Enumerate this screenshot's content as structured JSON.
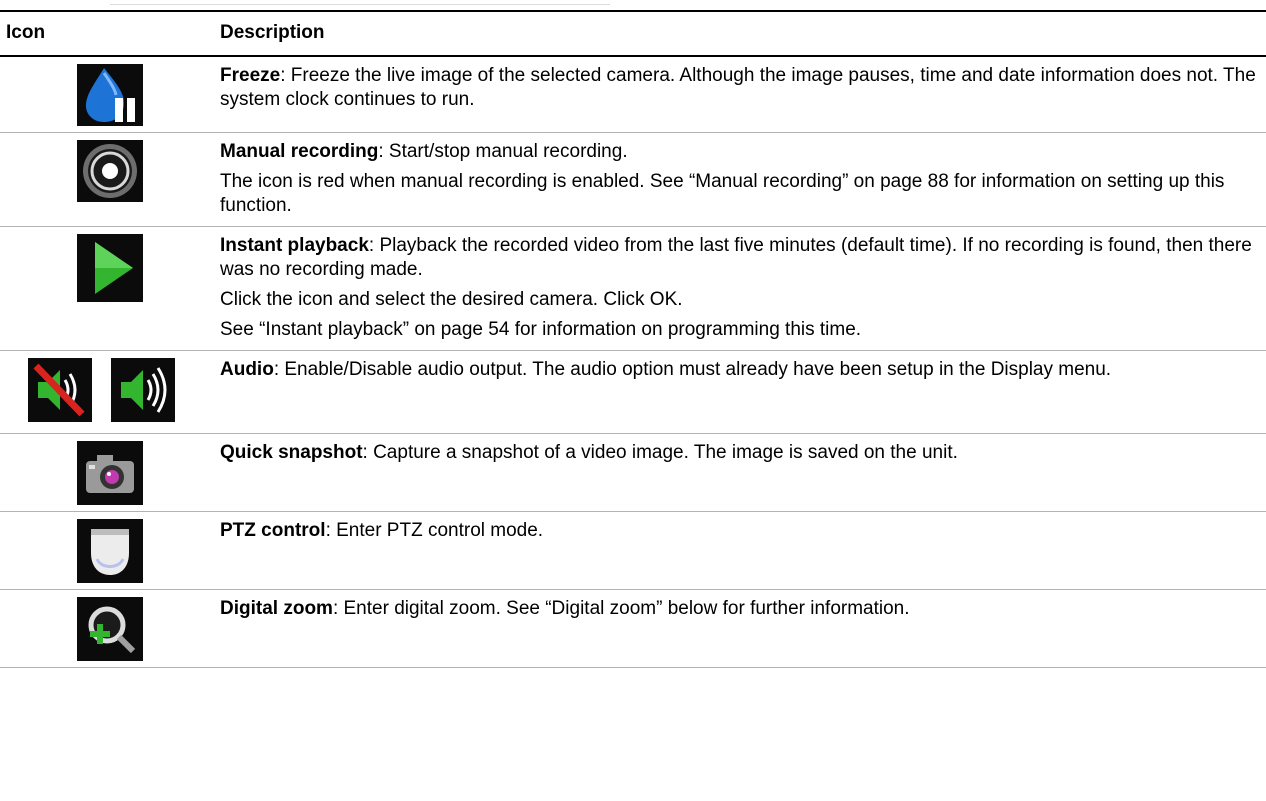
{
  "table": {
    "header": {
      "icon": "Icon",
      "description": "Description"
    },
    "rows": [
      {
        "icon": "freeze-icon",
        "term": "Freeze",
        "paragraphs": [
          ": Freeze the live image of the selected camera. Although the image pauses, time and date information does not. The system clock continues to run."
        ]
      },
      {
        "icon": "manual-recording-icon",
        "term": "Manual recording",
        "paragraphs": [
          ": Start/stop manual recording.",
          "The icon is red when manual recording is enabled. See “Manual recording” on page 88 for information on setting up this function."
        ]
      },
      {
        "icon": "instant-playback-icon",
        "term": "Instant playback",
        "paragraphs": [
          ": Playback the recorded video from the last five minutes (default time). If no recording is found, then there was no recording made.",
          "Click the icon and select the desired camera. Click OK.",
          "See “Instant playback” on page 54 for information on programming this time."
        ]
      },
      {
        "icon": "audio-off-icon / audio-on-icon",
        "term": "Audio",
        "paragraphs": [
          ": Enable/Disable audio output. The audio option must already have been setup in the Display menu."
        ]
      },
      {
        "icon": "camera-snapshot-icon",
        "term": "Quick snapshot",
        "paragraphs": [
          ": Capture a snapshot of a video image. The image is saved on the unit."
        ]
      },
      {
        "icon": "ptz-dome-camera-icon",
        "term": "PTZ control",
        "paragraphs": [
          ": Enter PTZ control mode."
        ]
      },
      {
        "icon": "digital-zoom-magnifier-icon",
        "term": "Digital zoom",
        "paragraphs": [
          ": Enter digital zoom. See “Digital zoom” below for further information."
        ]
      }
    ]
  },
  "colors": {
    "icon_background": "#0b0b0b",
    "freeze_blue": "#1e73d6",
    "playback_green": "#33b52f",
    "mute_red": "#d8241f",
    "row_rule": "#b3b3b3"
  }
}
